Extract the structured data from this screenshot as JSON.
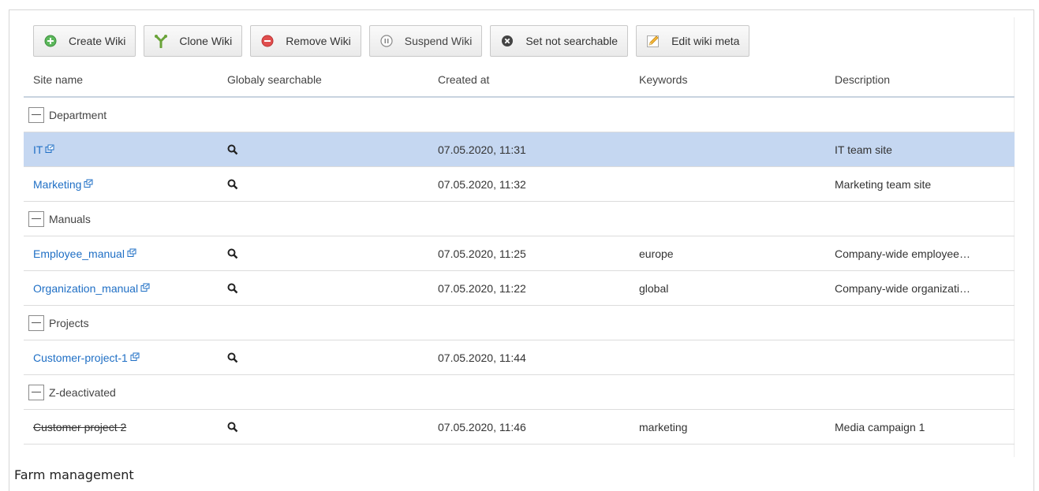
{
  "toolbar": {
    "create": "Create Wiki",
    "clone": "Clone Wiki",
    "remove": "Remove Wiki",
    "suspend": "Suspend Wiki",
    "not_searchable": "Set not searchable",
    "edit_meta": "Edit wiki meta"
  },
  "columns": [
    "Site name",
    "Globaly searchable",
    "Created at",
    "Keywords",
    "Description"
  ],
  "groups": [
    {
      "label": "Department"
    },
    {
      "label": "Manuals"
    },
    {
      "label": "Projects"
    },
    {
      "label": "Z-deactivated"
    }
  ],
  "rows": [
    {
      "name": "IT",
      "created": "07.05.2020, 11:31",
      "keywords": "",
      "description": "IT team site"
    },
    {
      "name": "Marketing",
      "created": "07.05.2020, 11:32",
      "keywords": "",
      "description": "Marketing team site"
    },
    {
      "name": "Employee_manual",
      "created": "07.05.2020, 11:25",
      "keywords": "europe",
      "description": "Company-wide employee…"
    },
    {
      "name": "Organization_manual",
      "created": "07.05.2020, 11:22",
      "keywords": "global",
      "description": "Company-wide organizati…"
    },
    {
      "name": "Customer-project-1",
      "created": "07.05.2020, 11:44",
      "keywords": "",
      "description": ""
    },
    {
      "name": "Customer project 2",
      "created": "07.05.2020, 11:46",
      "keywords": "marketing",
      "description": "Media campaign 1"
    }
  ],
  "caption": "Farm management",
  "colors": {
    "link": "#1f6fc5",
    "selected_row": "#c5d7f1"
  }
}
